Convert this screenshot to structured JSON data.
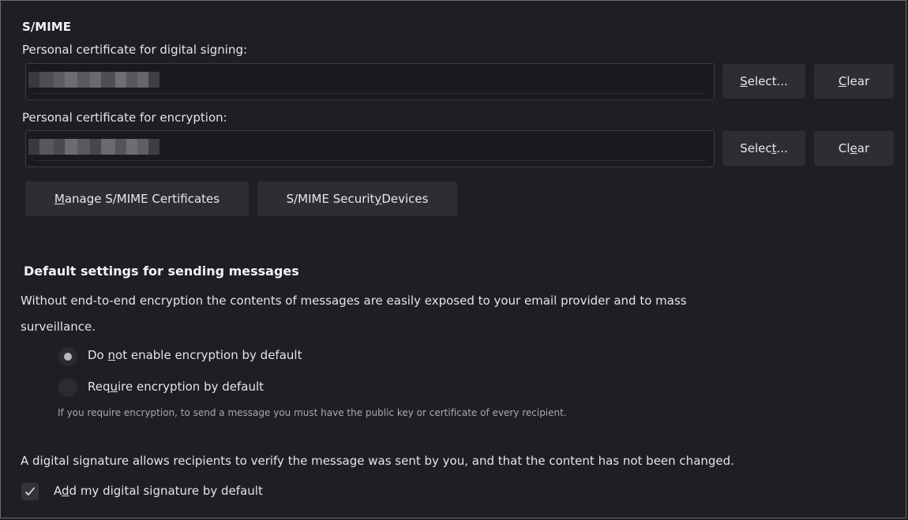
{
  "smime": {
    "heading": "S/MIME",
    "signing_label": "Personal certificate for digital signing:",
    "signing": {
      "select_pre": "",
      "select_ul": "S",
      "select_post": "elect...",
      "clear_pre": "",
      "clear_ul": "C",
      "clear_post": "lear"
    },
    "encryption_label": "Personal certificate for encryption:",
    "encryption": {
      "select_pre": "Selec",
      "select_ul": "t",
      "select_post": "...",
      "clear_pre": "Cl",
      "clear_ul": "e",
      "clear_post": "ar"
    },
    "manage_pre": "",
    "manage_ul": "M",
    "manage_post": "anage S/MIME Certificates",
    "devices_pre": "S/MIME Securit",
    "devices_ul": "y",
    "devices_post": " Devices"
  },
  "defaults": {
    "heading": "Default settings for sending messages",
    "description_line1": "Without end-to-end encryption the contents of messages are easily exposed to your email provider and to mass",
    "description_line2": "surveillance.",
    "radio1_pre": "Do ",
    "radio1_ul": "n",
    "radio1_post": "ot enable encryption by default",
    "radio2_pre": "Req",
    "radio2_ul": "u",
    "radio2_post": "ire encryption by default",
    "note": "If you require encryption, to send a message you must have the public key or certificate of every recipient.",
    "signature_text": "A digital signature allows recipients to verify the message was sent by you, and that the content has not been changed.",
    "checkbox_pre": "A",
    "checkbox_ul": "d",
    "checkbox_post": "d my digital signature by default",
    "checkbox_checked": true
  },
  "colors": {
    "background": "#1f1e23",
    "button": "#2e2d33",
    "field": "#1a191e"
  }
}
